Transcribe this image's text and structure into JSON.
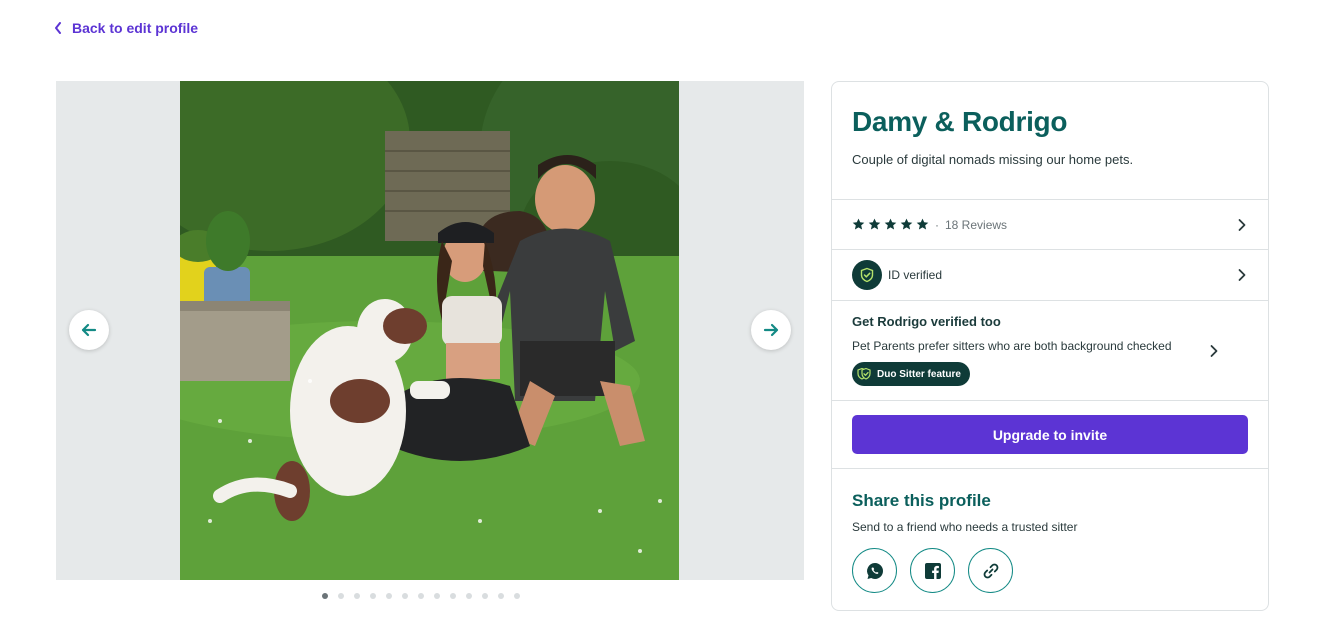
{
  "back_link": {
    "label": "Back to edit profile"
  },
  "carousel": {
    "total_photos": 13,
    "active_index": 0,
    "prev_icon": "arrow-left-icon",
    "next_icon": "arrow-right-icon"
  },
  "profile": {
    "name": "Damy & Rodrigo",
    "tagline": "Couple of digital nomads missing our home pets."
  },
  "reviews": {
    "rating": 5,
    "separator": "·",
    "label": "18 Reviews"
  },
  "id_verification": {
    "label": "ID verified",
    "icon": "shield-check-icon"
  },
  "duo": {
    "title": "Get Rodrigo verified too",
    "subtitle": "Pet Parents prefer sitters who are both background checked",
    "badge": "Duo Sitter feature"
  },
  "upgrade": {
    "label": "Upgrade to invite"
  },
  "share": {
    "title": "Share this profile",
    "subtitle": "Send to a friend who needs a trusted sitter",
    "buttons": [
      "whatsapp-icon",
      "facebook-icon",
      "link-icon"
    ]
  },
  "colors": {
    "brand_purple": "#5c34d4",
    "brand_teal": "#0b5f5c",
    "dark_teal": "#0f3b38",
    "accent_teal": "#138a85"
  }
}
